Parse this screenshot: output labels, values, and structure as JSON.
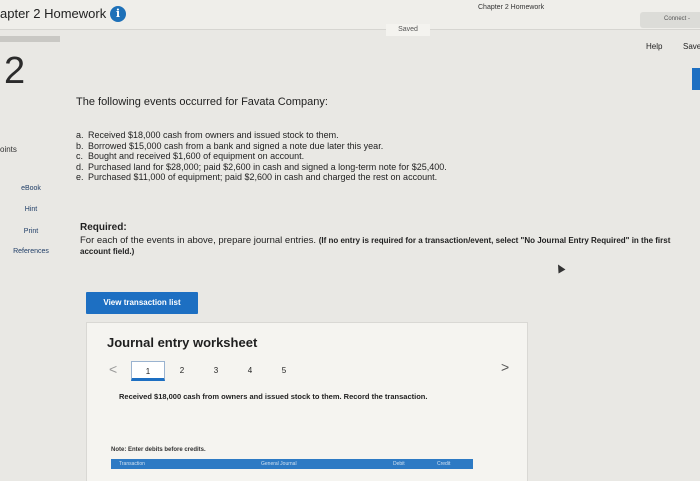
{
  "header": {
    "assignment_title": "apter 2 Homework",
    "chapter_tab": "Chapter 2 Homework",
    "connect": "Connect -",
    "saved": "Saved",
    "help": "Help",
    "save": "Save",
    "info_glyph": "i"
  },
  "question": {
    "number": "2",
    "points_label": "oints",
    "intro": "The following events occurred for Favata Company:",
    "events": [
      {
        "letter": "a.",
        "text": "Received $18,000 cash from owners and issued stock to them."
      },
      {
        "letter": "b.",
        "text": "Borrowed $15,000 cash from a bank and signed a note due later this year."
      },
      {
        "letter": "c.",
        "text": "Bought and received $1,600 of equipment on account."
      },
      {
        "letter": "d.",
        "text": "Purchased land for $28,000; paid $2,600 in cash and signed a long-term note for $25,400."
      },
      {
        "letter": "e.",
        "text": "Purchased $11,000 of equipment; paid $2,600 in cash and charged the rest on account."
      }
    ],
    "required_heading": "Required:",
    "required_text": "For each of the events in above, prepare journal entries.",
    "required_bold": "(If no entry is required for a transaction/event, select \"No Journal Entry Required\" in the first account field.)"
  },
  "sidebar": {
    "ebook": "eBook",
    "hint": "Hint",
    "print": "Print",
    "references": "References"
  },
  "worksheet": {
    "view_button": "View transaction list",
    "title": "Journal entry worksheet",
    "prev": "<",
    "next": ">",
    "pages": [
      "1",
      "2",
      "3",
      "4",
      "5"
    ],
    "active_page": "1",
    "description": "Received $18,000 cash from owners and issued stock to them. Record the transaction.",
    "note": "Note: Enter debits before credits.",
    "columns": [
      "Transaction",
      "General Journal",
      "Debit",
      "Credit"
    ]
  },
  "colors": {
    "accent": "#1d6fc2",
    "info": "#1d70b8"
  }
}
